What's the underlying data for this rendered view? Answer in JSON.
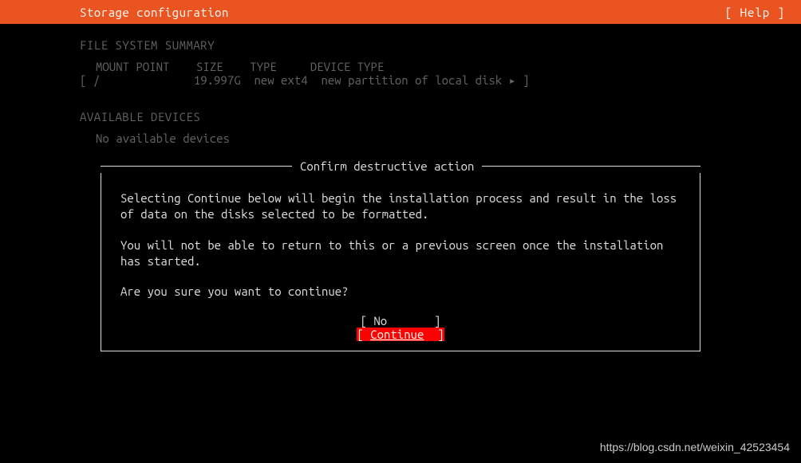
{
  "header": {
    "title": "Storage configuration",
    "help": "[ Help ]"
  },
  "fs_summary": {
    "heading": "FILE SYSTEM SUMMARY",
    "columns": {
      "mount_point": "MOUNT POINT",
      "size": "SIZE",
      "type": "TYPE",
      "device_type": "DEVICE TYPE"
    },
    "row": {
      "mount_point": "/",
      "size": "19.997G",
      "type": "new ext4",
      "device_type": "new partition of local disk ▸"
    }
  },
  "available": {
    "heading": "AVAILABLE DEVICES",
    "empty": "No available devices"
  },
  "dialog": {
    "title": "Confirm destructive action",
    "p1": "Selecting Continue below will begin the installation process and result in the loss of data on the disks selected to be formatted.",
    "p2": "You will not be able to return to this or a previous screen once the installation has started.",
    "p3": "Are you sure you want to continue?",
    "no_label": "No",
    "continue_label": "Continue"
  },
  "watermark": "https://blog.csdn.net/weixin_42523454"
}
